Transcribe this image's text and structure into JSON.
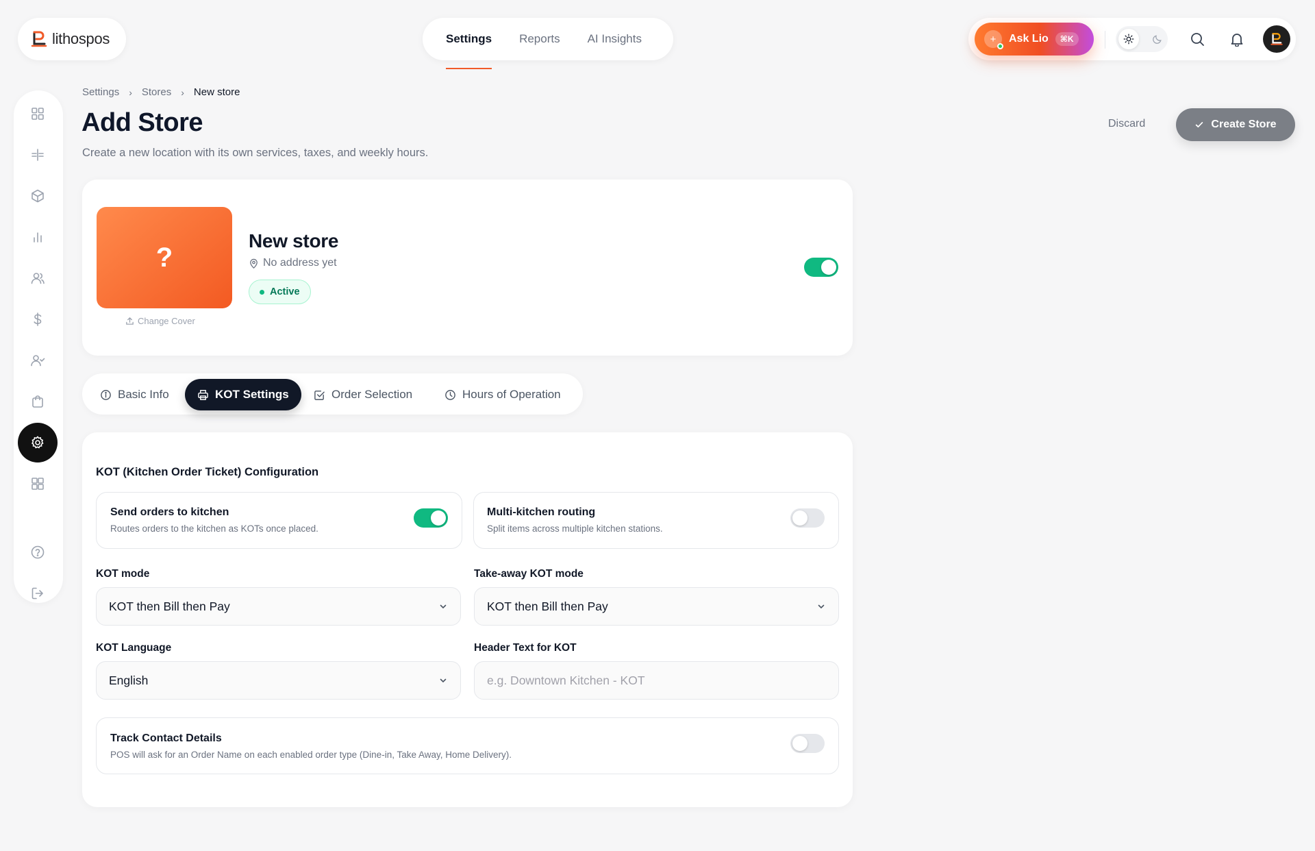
{
  "brand": {
    "name": "lithospos"
  },
  "topnav": {
    "items": [
      {
        "label": "Settings",
        "active": true
      },
      {
        "label": "Reports",
        "active": false
      },
      {
        "label": "AI Insights",
        "active": false
      }
    ]
  },
  "assistant": {
    "label": "Ask Lio",
    "shortcut": "⌘K"
  },
  "breadcrumb": {
    "items": [
      "Settings",
      "Stores"
    ],
    "current": "New store"
  },
  "page": {
    "title": "Add Store",
    "subtitle": "Create a new location with its own services, taxes, and weekly hours."
  },
  "actions": {
    "discard": "Discard",
    "create": "Create Store"
  },
  "store": {
    "cover_placeholder": "?",
    "change_cover": "Change Cover",
    "name": "New store",
    "address": "No address yet",
    "status": "Active",
    "enabled": true
  },
  "tabs": [
    {
      "label": "Basic Info",
      "icon": "info-icon",
      "active": false
    },
    {
      "label": "KOT Settings",
      "icon": "printer-icon",
      "active": true
    },
    {
      "label": "Order Selection",
      "icon": "checkbox-icon",
      "active": false
    },
    {
      "label": "Hours of Operation",
      "icon": "clock-icon",
      "active": false
    }
  ],
  "kot": {
    "section_title": "KOT (Kitchen Order Ticket) Configuration",
    "send_orders": {
      "title": "Send orders to kitchen",
      "description": "Routes orders to the kitchen as KOTs once placed.",
      "enabled": true
    },
    "multi_kitchen": {
      "title": "Multi-kitchen routing",
      "description": "Split items across multiple kitchen stations.",
      "enabled": false
    },
    "mode": {
      "label": "KOT mode",
      "value": "KOT then Bill then Pay"
    },
    "takeaway_mode": {
      "label": "Take-away KOT mode",
      "value": "KOT then Bill then Pay"
    },
    "language": {
      "label": "KOT Language",
      "value": "English"
    },
    "header_text": {
      "label": "Header Text for KOT",
      "value": "",
      "placeholder": "e.g. Downtown Kitchen - KOT"
    },
    "track_contact": {
      "title": "Track Contact Details",
      "description": "POS will ask for an Order Name on each enabled order type (Dine-in, Take Away, Home Delivery).",
      "enabled": false
    }
  },
  "colors": {
    "accent": "#f05a28",
    "success": "#10b981",
    "dark": "#111827"
  }
}
